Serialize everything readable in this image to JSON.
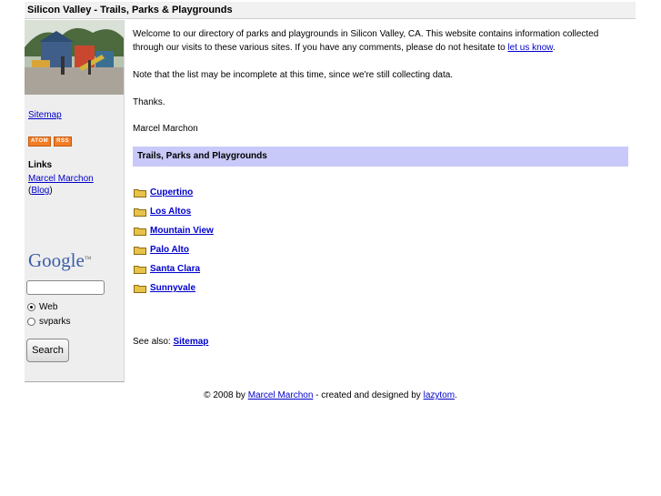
{
  "header": {
    "title": "Silicon Valley - Trails, Parks & Playgrounds"
  },
  "sidebar": {
    "sitemap_label": "Sitemap",
    "badges": [
      "ATOM",
      "RSS"
    ],
    "links_heading": "Links",
    "links": [
      {
        "label": "Marcel Marchon"
      },
      {
        "label": "Blog",
        "prefix": "(",
        "suffix": ")"
      }
    ],
    "google_logo": "Google",
    "google_tm": "TM",
    "search": {
      "value": "",
      "options": [
        {
          "label": "Web",
          "checked": true
        },
        {
          "label": "svparks",
          "checked": false
        }
      ],
      "button_label": "Search"
    }
  },
  "main": {
    "intro_text": "Welcome to our directory of parks and playgrounds in Silicon Valley, CA. This website contains information collected through our visits to these various sites. If you have any comments, please do not hesitate to ",
    "intro_link": "let us know",
    "intro_end": ".",
    "note": "Note that the list may be incomplete at this time, since we're still collecting data.",
    "thanks": "Thanks.",
    "author": "Marcel Marchon",
    "section_title": "Trails, Parks and Playgrounds",
    "cities": [
      "Cupertino",
      "Los Altos",
      "Mountain View",
      "Palo Alto",
      "Santa Clara",
      "Sunnyvale"
    ],
    "see_also_label": "See also: ",
    "see_also_link": "Sitemap"
  },
  "footer": {
    "prefix": "© 2008 by ",
    "author_link": "Marcel Marchon",
    "middle": " - created and designed by ",
    "designer_link": "lazytom",
    "suffix": "."
  },
  "colors": {
    "section_bar": "#c9c9f9",
    "link": "#0000cc",
    "badge": "#f47c24",
    "folder": "#e8c34a"
  }
}
